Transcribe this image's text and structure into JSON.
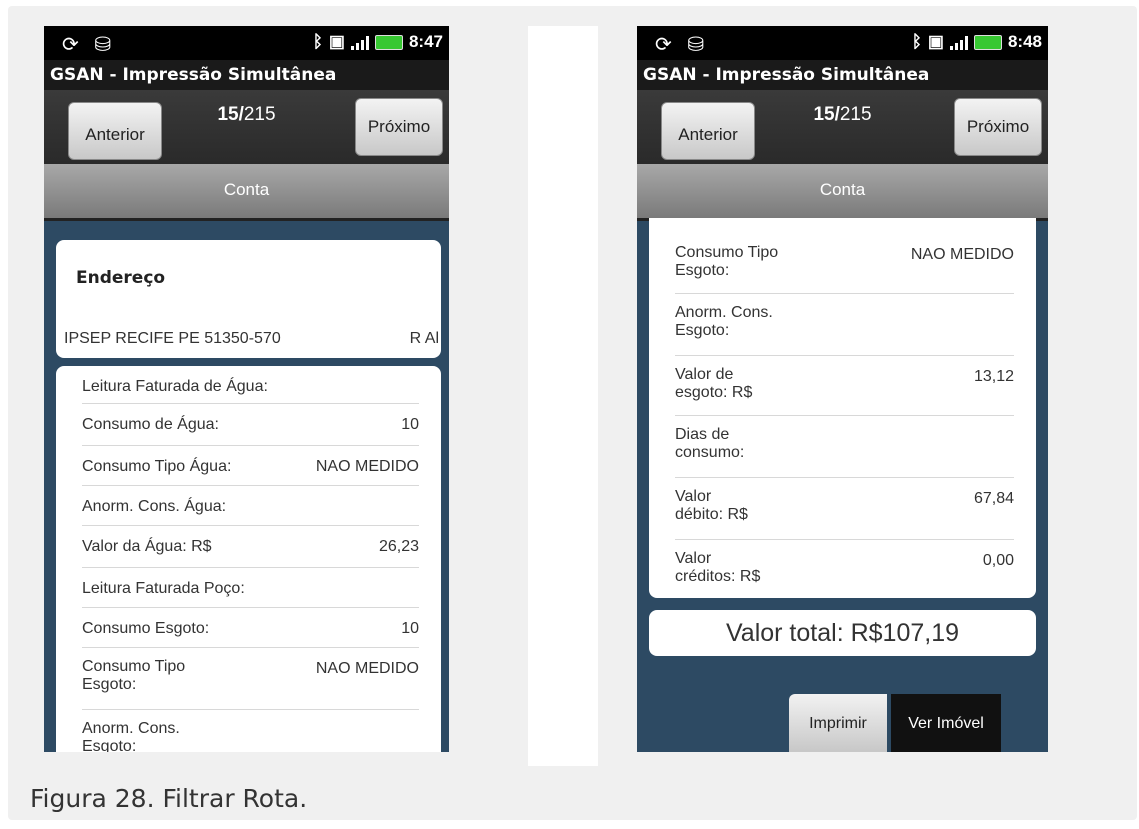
{
  "caption": "Figura 28. Filtrar Rota.",
  "screen1": {
    "status_time": "8:47",
    "app_title": "GSAN - Impressão Simultânea",
    "prev_label": "Anterior",
    "next_label": "Próximo",
    "counter_current": "15/",
    "counter_total": "215",
    "tab_label": "Conta",
    "address_heading": "Endereço",
    "address_line": "IPSEP RECIFE PE 51350-570",
    "address_extra": "R Al",
    "rows": [
      {
        "label": "Leitura Faturada de Água:",
        "value": ""
      },
      {
        "label": "Consumo de Água:",
        "value": "10"
      },
      {
        "label": "Consumo Tipo Água:",
        "value": "NAO MEDIDO"
      },
      {
        "label": "Anorm. Cons. Água:",
        "value": ""
      },
      {
        "label": "Valor da Água: R$",
        "value": "26,23"
      },
      {
        "label": "Leitura Faturada Poço:",
        "value": ""
      },
      {
        "label": "Consumo Esgoto:",
        "value": "10"
      },
      {
        "label": "Consumo Tipo\nEsgoto:",
        "value": "NAO MEDIDO"
      },
      {
        "label": "Anorm. Cons.\nEsgoto:",
        "value": ""
      }
    ]
  },
  "screen2": {
    "status_time": "8:48",
    "app_title": "GSAN - Impressão Simultânea",
    "prev_label": "Anterior",
    "next_label": "Próximo",
    "counter_current": "15/",
    "counter_total": "215",
    "tab_label": "Conta",
    "rows": [
      {
        "label": "Consumo Tipo\nEsgoto:",
        "value": "NAO MEDIDO"
      },
      {
        "label": "Anorm. Cons.\nEsgoto:",
        "value": ""
      },
      {
        "label": "Valor de\nesgoto: R$",
        "value": "13,12"
      },
      {
        "label": "Dias de\nconsumo:",
        "value": ""
      },
      {
        "label": "Valor\ndébito: R$",
        "value": "67,84"
      },
      {
        "label": "Valor\ncréditos: R$",
        "value": "0,00"
      }
    ],
    "total_label": "Valor total: R$107,19",
    "print_label": "Imprimir",
    "view_label": "Ver Imóvel"
  }
}
